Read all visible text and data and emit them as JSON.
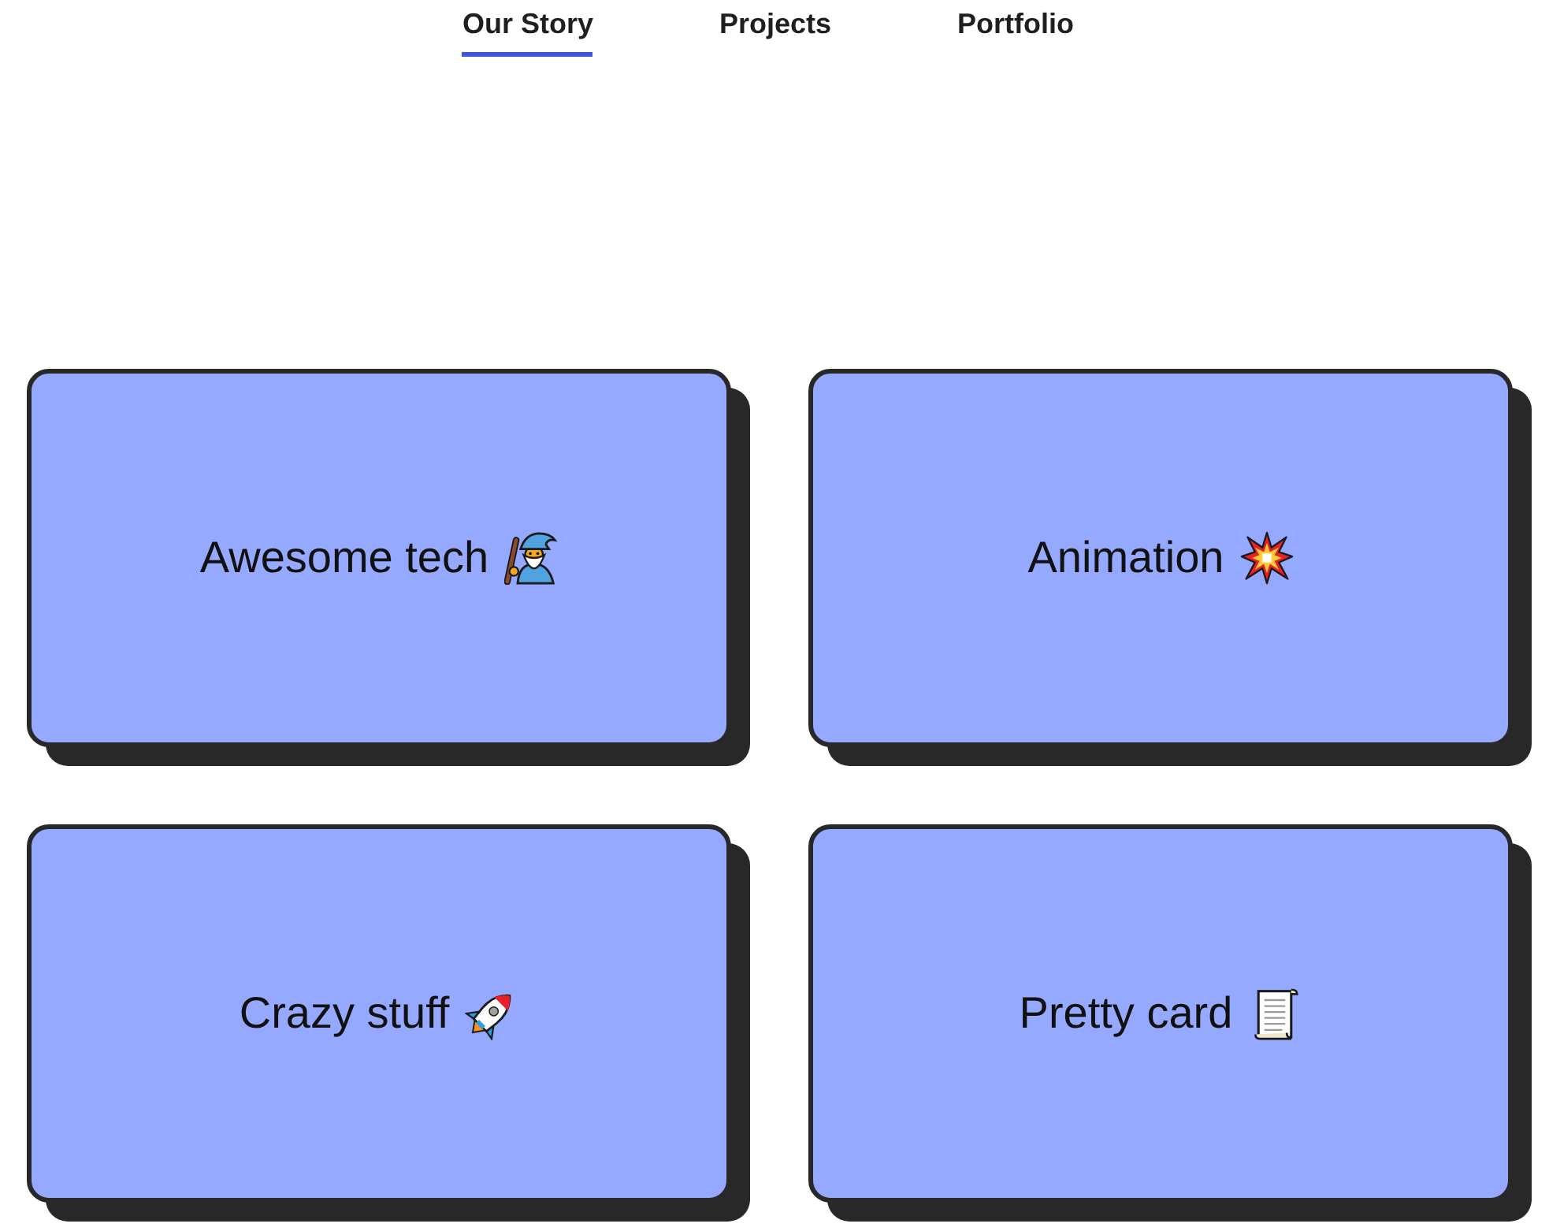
{
  "nav": {
    "tabs": [
      {
        "label": "Our Story",
        "selected": true
      },
      {
        "label": "Projects",
        "selected": false
      },
      {
        "label": "Portfolio",
        "selected": false
      }
    ]
  },
  "cards": [
    {
      "title": "Awesome tech"
    },
    {
      "title": "Animation"
    },
    {
      "title": "Crazy stuff"
    },
    {
      "title": "Pretty card"
    }
  ]
}
